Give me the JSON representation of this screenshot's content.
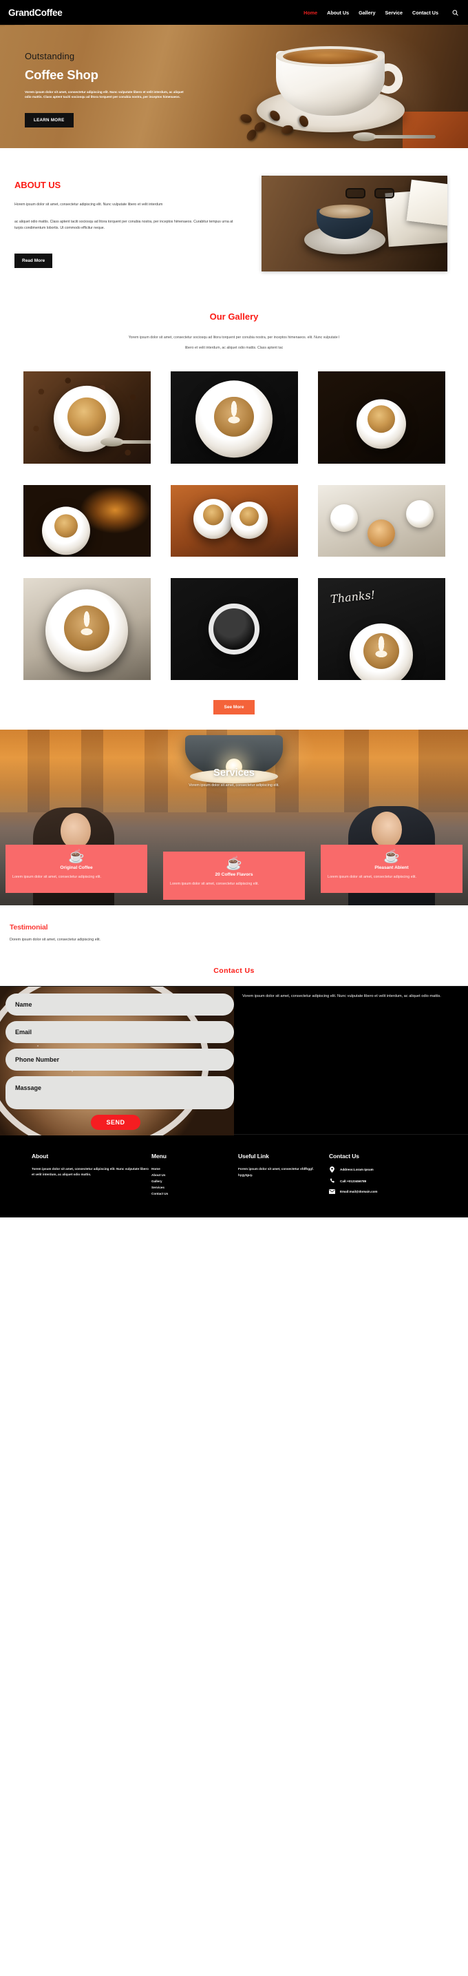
{
  "brand": {
    "name": "GrandCoffee",
    "accent_red": "#fb1a14",
    "accent_coral": "#f96a6a",
    "accent_teal": "#17d1a6",
    "accent_orange": "#f4633a"
  },
  "nav": {
    "logo": "GrandCoffee",
    "items": [
      {
        "label": "Home",
        "active": true
      },
      {
        "label": "About Us",
        "active": false
      },
      {
        "label": "Gallery",
        "active": false
      },
      {
        "label": "Service",
        "active": false
      },
      {
        "label": "Contact Us",
        "active": false
      }
    ],
    "search_icon": "search-icon"
  },
  "hero": {
    "eyebrow": "Outstanding",
    "title": "Coffee Shop",
    "text": "Vorem ipsum dolor sit amet, consectetur adipiscing elit. Nunc vulputate libero et velit interdum, ac aliquet odio mattis. Class aptent taciti sociosqu ad litora torquent per conubia nostra, per inceptos himenaeos.",
    "button": "LEARN MORE"
  },
  "about": {
    "title": "ABOUT US",
    "paragraph1": "Horem ipsum dolor sit amet, consectetur adipiscing elit. Nunc vulputate libero et velit interdum",
    "paragraph2": "ac aliquet odio mattis. Class aptent taciti sociosqu ad litora torquent per conubia nostra, per inceptos himenaeos. Curabitur tempus urna at turpis condimentum lobortis. Ut commodo efficitur neque.",
    "button": "Read More"
  },
  "gallery": {
    "title": "Our Gallery",
    "subtitle_line1": "Yorem ipsum dolor sit amet, consectetur sociosqu ad litora torquent per conubia nostra, per inceptos himenaeos. elit. Nunc vulputate l",
    "subtitle_line2": "libero et velit interdum, ac aliquet odio mattis. Class aptent tac",
    "see_more": "See More",
    "items": [
      {
        "name": "espresso-on-beans",
        "style": "beans"
      },
      {
        "name": "latte-art-cup-dark",
        "style": "dark"
      },
      {
        "name": "steaming-cup-beans",
        "style": "steam"
      },
      {
        "name": "cup-by-fireplace",
        "style": "fire"
      },
      {
        "name": "two-cappuccinos-pastry",
        "style": "cafe"
      },
      {
        "name": "breakfast-table-top",
        "style": "table"
      },
      {
        "name": "latte-art-white-cup",
        "style": "latteart"
      },
      {
        "name": "black-coffee-mug",
        "style": "blackmug"
      },
      {
        "name": "thanks-chalkboard",
        "style": "thanks",
        "overlay_text": "Thanks!"
      }
    ]
  },
  "services": {
    "title": "Services",
    "subtitle": "Vorem ipsum dolor sit amet, consectetur adipiscing elit.",
    "cards": [
      {
        "icon": "coffee-cup-icon",
        "title": "Original Coffee",
        "desc": "Lorem ipsum dolor sit amet, consectetur adipiscing elit."
      },
      {
        "icon": "coffee-cup-icon",
        "title": "20 Coffee Flavors",
        "desc": "Lorem ipsum dolor sit amet, consectetur adipiscing elit."
      },
      {
        "icon": "coffee-cup-icon",
        "title": "Pleasant Abient",
        "desc": "Lorem ipsum dolor sit amet, consectetur adipiscing elit."
      }
    ]
  },
  "testimonial": {
    "title": "Testimonial",
    "subtitle": "Dorem ipsum dolor sit amet, consectetur adipiscing elit."
  },
  "contact": {
    "title": "Contact  Us",
    "fields": {
      "name": "Name",
      "email": "Email",
      "phone": "Phone Number",
      "message": "Massage"
    },
    "send_button": "SEND",
    "side_text": "Vorem ipsum dolor sit amet, consectetur adipiscing elit. Nunc vulputate libero et velit interdum, ac aliquet odio mattis."
  },
  "footer": {
    "about": {
      "heading": "About",
      "text": "Torem ipsum dolor sit amet, consectetur adipiscing elit. Nunc vulputate libero et velit interdum, ac aliquet odio mattis."
    },
    "menu": {
      "heading": "Menu",
      "items": [
        "Home",
        "About Us",
        "Gallery",
        "Services",
        "Contact Us"
      ]
    },
    "useful_link": {
      "heading": "Useful Link",
      "text": "Forem ipsum dolor sit amet, consectetur sfdfhggf. hygytguy."
    },
    "contact": {
      "heading": "Contact Us",
      "rows": [
        {
          "icon": "location-pin-icon",
          "text": "Address:Loram Ipsum"
        },
        {
          "icon": "phone-icon",
          "text": "Call:+0123456789"
        },
        {
          "icon": "envelope-icon",
          "text": "Email:mail@domain.com"
        }
      ]
    }
  }
}
